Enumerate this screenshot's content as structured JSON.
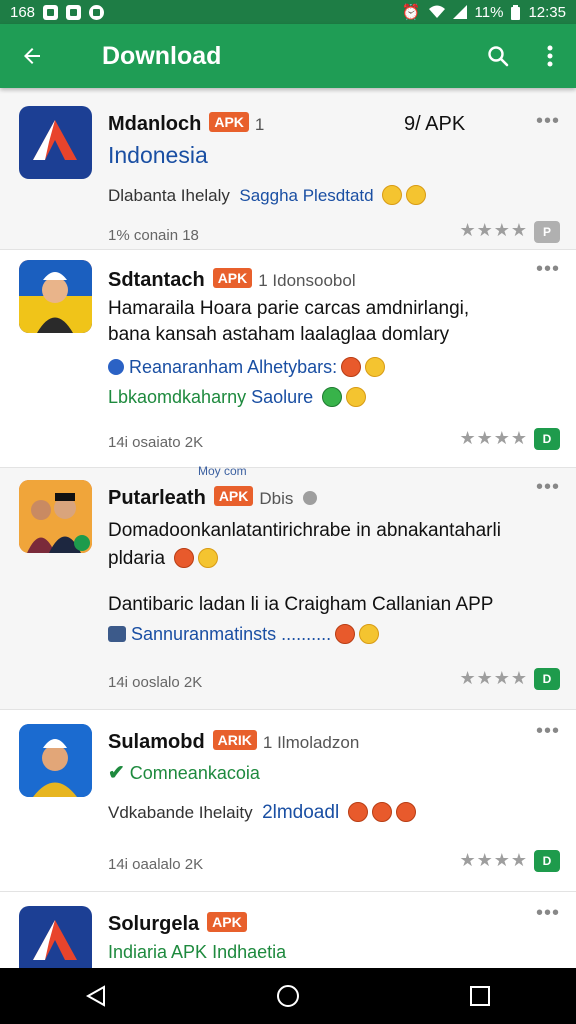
{
  "status_bar": {
    "left": "168",
    "time": "12:35",
    "battery": "11%"
  },
  "app_bar": {
    "title": "Download"
  },
  "items": [
    {
      "name": "Mdanloch",
      "badge": "APK",
      "after_badge": "1",
      "apk_right": "9/ APK",
      "line1": "Indonesia",
      "line2_a": "Dlabanta Ihelaly",
      "line2_b": "Saggha Plesdtatd",
      "meta": "1% conain 18",
      "stars": "★★★★",
      "chip": "P"
    },
    {
      "name": "Sdtantach",
      "badge": "APK",
      "after_badge": "1 Idonsoobol",
      "line1": "Hamaraila Hoara parie carcas amdnirlangi,",
      "line1b": "bana kansah astaham laalaglaa domlary",
      "line2": "Reanaranham Alhetybars:",
      "line3_a": "Lbkaomdkaharny",
      "line3_b": "Saolure",
      "meta": "14i osaiato 2K",
      "stars": "★★★★",
      "chip": "D"
    },
    {
      "name": "Putarleath",
      "badge": "APK",
      "after_badge": "Dbis",
      "header_note": "Moy com",
      "line1": "Domadoonkanlatantirichrabe in abnakantaharli",
      "line1b": "pldaria",
      "line2": "Dantibaric ladan li ia Craigham Callanian APP",
      "line3": "Sannuranmatinsts ..........",
      "meta": "14i ooslalo 2K",
      "stars": "★★★★",
      "chip": "D"
    },
    {
      "name": "Sulamobd",
      "badge": "ARIK",
      "after_badge": "1 Ilmoladzon",
      "line1": "Comneankacoia",
      "line2_a": "Vdkabande Ihelaity",
      "line2_b": "2lmdoadl",
      "meta": "14i oaalalo 2K",
      "stars": "★★★★",
      "chip": "D"
    },
    {
      "name": "Solurgela",
      "badge": "APK",
      "line1": "Indiaria APK Indhaetia"
    }
  ],
  "icons": {
    "back": "arrow-left-icon",
    "search": "search-icon",
    "more": "more-vert-icon",
    "nav_back": "triangle-back-icon",
    "nav_home": "circle-home-icon",
    "nav_recent": "square-recents-icon"
  },
  "colors": {
    "app_bar": "#1f9d55",
    "status_bar": "#1e7d45",
    "badge": "#e8602c",
    "chip": "#1e9b4c"
  }
}
